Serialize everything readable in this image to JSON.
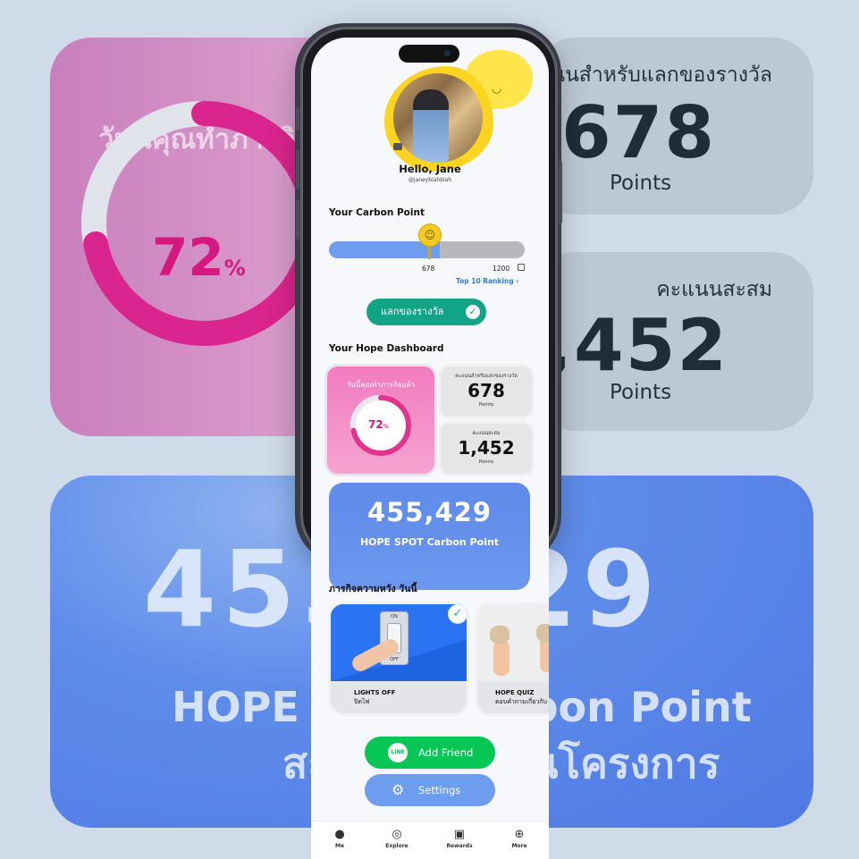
{
  "background": {
    "daily_title": "วันนี้คุณทำภารกิจแล้ว",
    "daily_percent": "72",
    "percent_sign": "%",
    "redeemable_label": "คะแนนสำหรับแลกของรางวัล",
    "redeemable_value": "678",
    "redeemable_unit": "Points",
    "accumulated_label": "คะแนนสะสม",
    "accumulated_value": "1,452",
    "accumulated_unit": "Points",
    "hope_spot_value": "455,429",
    "hope_spot_line1": "HOPE SPOT Carbon Point",
    "hope_spot_line2": "สะสมทั้งหมดในโครงการ"
  },
  "profile": {
    "greeting": "Hello, Jane",
    "handle": "@janeyblahblah"
  },
  "carbon": {
    "section_title": "Your Carbon Point",
    "current": "678",
    "max": "1200",
    "progress_fraction": 0.565,
    "ranking_link": "Top 10 Ranking ›",
    "redeem_button": "แลกของรางวัล"
  },
  "dashboard": {
    "section_title": "Your Hope Dashboard",
    "daily_title": "วันนี้คุณทำภารกิจแล้ว",
    "daily_percent": "72",
    "daily_fraction": 0.72,
    "percent_sign": "%",
    "redeemable_label": "คะแนนสำหรับแลกของรางวัล",
    "redeemable_value": "678",
    "redeemable_unit": "Points",
    "accumulated_label": "คะแนนสะสม",
    "accumulated_value": "1,452",
    "accumulated_unit": "Points",
    "hope_spot_value": "455,429",
    "hope_spot_label": "HOPE SPOT Carbon Point"
  },
  "missions": {
    "section_title": "ภารกิจความหวัง วันนี้",
    "items": [
      {
        "title": "LIGHTS OFF",
        "subtitle": "ปิดไฟ",
        "switch_on": "ON",
        "switch_off": "OFF",
        "completed": true
      },
      {
        "title": "HOPE QUIZ",
        "subtitle": "ตอบคำถามเกี่ยวกับ",
        "completed": false
      }
    ]
  },
  "buttons": {
    "line_icon_text": "LINE",
    "add_friend": "Add Friend",
    "settings": "Settings"
  },
  "tabbar": {
    "items": [
      {
        "label": "Me",
        "icon": "person-icon"
      },
      {
        "label": "Explore",
        "icon": "compass-icon"
      },
      {
        "label": "Rewards",
        "icon": "gift-icon"
      },
      {
        "label": "More",
        "icon": "plus-circle-icon"
      }
    ]
  },
  "colors": {
    "accent_green": "#12a486",
    "line_green": "#06c755",
    "accent_blue": "#6e9df0",
    "pink": "#f27bc0",
    "magenta_text": "#d4187f",
    "sun_yellow": "#fde54a"
  }
}
